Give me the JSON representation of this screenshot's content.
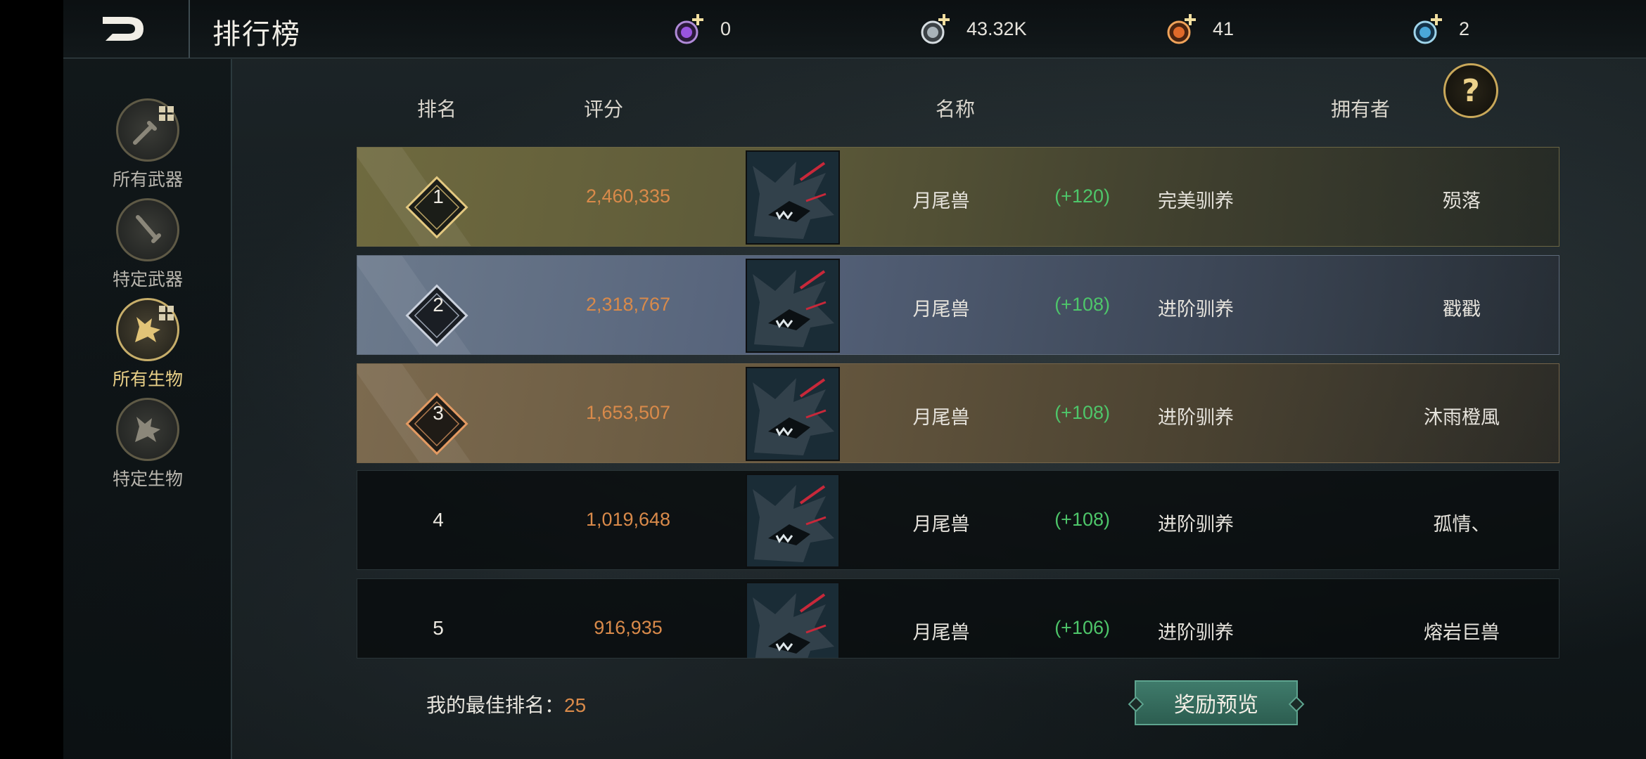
{
  "header": {
    "title": "排行榜",
    "currencies": [
      {
        "icon": "purple-gem-icon",
        "value": "0",
        "color": "#7a3fc9"
      },
      {
        "icon": "silver-coin-icon",
        "value": "43.32K",
        "color": "#b9c2c8"
      },
      {
        "icon": "orange-token-icon",
        "value": "41",
        "color": "#e06a2a"
      },
      {
        "icon": "blue-orb-icon",
        "value": "2",
        "color": "#4aa7d9"
      }
    ]
  },
  "sidebar": {
    "items": [
      {
        "label": "所有武器",
        "icon": "sword-grid-icon"
      },
      {
        "label": "特定武器",
        "icon": "sword-icon"
      },
      {
        "label": "所有生物",
        "icon": "beast-grid-icon",
        "active": true
      },
      {
        "label": "特定生物",
        "icon": "beast-icon"
      }
    ]
  },
  "table": {
    "headers": {
      "rank": "排名",
      "score": "评分",
      "name": "名称",
      "owner": "拥有者"
    },
    "rows": [
      {
        "rank": "1",
        "score": "2,460,335",
        "name": "月尾兽",
        "bonus": "(+120)",
        "tame": "完美驯养",
        "owner": "殒落",
        "tier": "gold"
      },
      {
        "rank": "2",
        "score": "2,318,767",
        "name": "月尾兽",
        "bonus": "(+108)",
        "tame": "进阶驯养",
        "owner": "戳戳",
        "tier": "silver"
      },
      {
        "rank": "3",
        "score": "1,653,507",
        "name": "月尾兽",
        "bonus": "(+108)",
        "tame": "进阶驯养",
        "owner": "沐雨橙風",
        "tier": "bronze"
      },
      {
        "rank": "4",
        "score": "1,019,648",
        "name": "月尾兽",
        "bonus": "(+108)",
        "tame": "进阶驯养",
        "owner": "孤情、",
        "tier": "plain"
      },
      {
        "rank": "5",
        "score": "916,935",
        "name": "月尾兽",
        "bonus": "(+106)",
        "tame": "进阶驯养",
        "owner": "熔岩巨兽",
        "tier": "plain"
      }
    ]
  },
  "footer": {
    "best_rank_label": "我的最佳排名：",
    "best_rank_value": "25",
    "reward_button": "奖励预览"
  },
  "help": {
    "label": "?"
  },
  "colors": {
    "score": "#d98a4a",
    "bonus": "#4ec66a",
    "gold_border": "#e3c880",
    "silver_border": "#c9d0dc",
    "bronze_border": "#e39a62",
    "accent_button": "#3f7b6b"
  }
}
